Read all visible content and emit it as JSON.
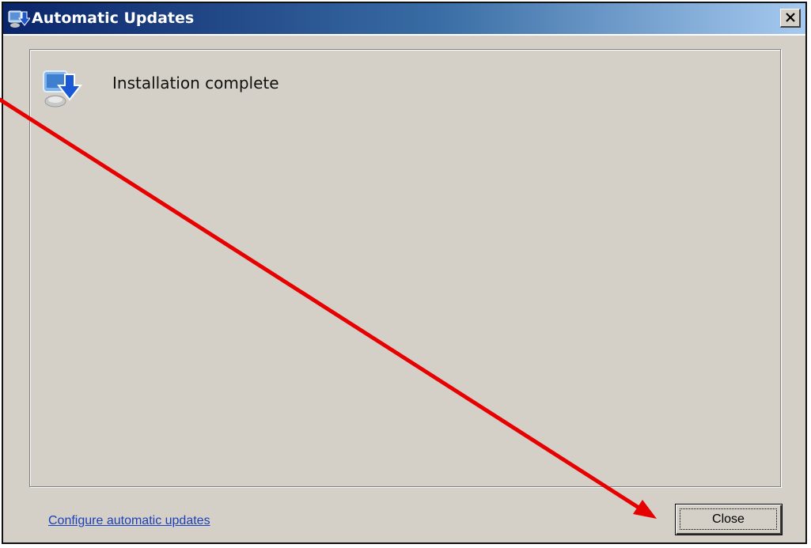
{
  "window": {
    "title": "Automatic Updates",
    "close_glyph": "✕"
  },
  "panel": {
    "icon": "windows-update-icon",
    "heading": "Installation complete"
  },
  "footer": {
    "link_label": "Configure automatic updates",
    "close_button_label": "Close"
  },
  "colors": {
    "dialog_background": "#d4d0c8",
    "titlebar_start": "#0a246a",
    "titlebar_end": "#a6caf0",
    "link": "#1a3fb8",
    "annotation_arrow": "#e60000"
  }
}
